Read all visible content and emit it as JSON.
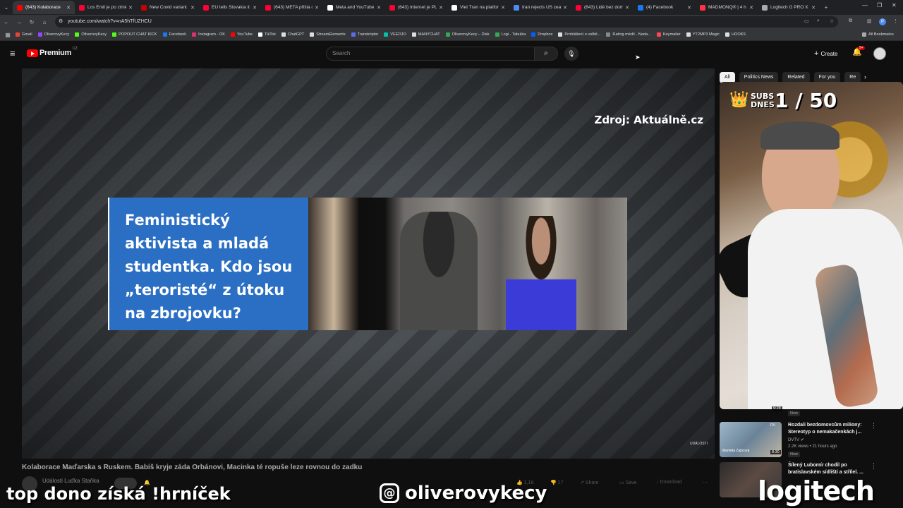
{
  "browser": {
    "tabs": [
      {
        "title": "(643) Kolaborace",
        "active": true,
        "color": "#ff0000"
      },
      {
        "title": "Los Emil je po zimě",
        "color": "#ff0033"
      },
      {
        "title": "New Covid variant",
        "color": "#cc0000"
      },
      {
        "title": "EU tells Slovakia it",
        "color": "#ff0033"
      },
      {
        "title": "(643) META přišla o",
        "color": "#ff0033"
      },
      {
        "title": "Meta and YouTube",
        "color": "#ffffff"
      },
      {
        "title": "(643) Internet je PL",
        "color": "#ff0033"
      },
      {
        "title": "Viet Tran na platfor",
        "color": "#ffffff"
      },
      {
        "title": "Iran rejects US cea",
        "color": "#4c8bf5"
      },
      {
        "title": "(643) Lidé bez dom",
        "color": "#ff0033"
      },
      {
        "title": "(4) Facebook",
        "color": "#1877f2"
      },
      {
        "title": "MADMONQ® | 4 h",
        "color": "#ff3344"
      },
      {
        "title": "Logitech G PRO X T",
        "color": "#aaaaaa"
      }
    ],
    "url": "youtube.com/watch?v=nA5hTfUZHCU",
    "bookmarks": [
      {
        "label": "Gmail",
        "color": "#ea4335"
      },
      {
        "label": "OliverovyKecy",
        "color": "#9146ff"
      },
      {
        "label": "OliverovyKecy",
        "color": "#53fc18"
      },
      {
        "label": "POPOUT CHAT KICK",
        "color": "#53fc18"
      },
      {
        "label": "Facebook",
        "color": "#1877f2"
      },
      {
        "label": "Instagram - OK",
        "color": "#e1306c"
      },
      {
        "label": "YouTube",
        "color": "#ff0000"
      },
      {
        "label": "TikTok",
        "color": "#ffffff"
      },
      {
        "label": "ChatGPT",
        "color": "#dddddd"
      },
      {
        "label": "StreamElements",
        "color": "#dddddd"
      },
      {
        "label": "Transkriptor",
        "color": "#5b6cf0"
      },
      {
        "label": "VEEDJO",
        "color": "#00c2a8"
      },
      {
        "label": "MANYCHAT",
        "color": "#dddddd"
      },
      {
        "label": "OliverovyKecy – Disk",
        "color": "#34a853"
      },
      {
        "label": "Logi - Tabulka",
        "color": "#34a853"
      },
      {
        "label": "Dropbox",
        "color": "#0061ff"
      },
      {
        "label": "Prohlášení o volbě...",
        "color": "#dddddd"
      },
      {
        "label": "Rating médií - Nada...",
        "color": "#888888"
      },
      {
        "label": "Keymailer",
        "color": "#ff4455"
      },
      {
        "label": "YT2MP3 Magic",
        "color": "#dddddd"
      },
      {
        "label": "HOOKS",
        "color": "#dddddd"
      }
    ],
    "all_bookmarks": "All Bookmarks"
  },
  "youtube": {
    "logo": "Premium",
    "region": "CZ",
    "search_placeholder": "Search",
    "create_label": "Create",
    "notif_count": "9+",
    "chips": [
      "All",
      "Politics News",
      "Related",
      "For you",
      "Re"
    ]
  },
  "video": {
    "source_label": "Zdroj: Aktuálně.cz",
    "card_title": "Feministický aktivista a mladá studentka. Kdo jsou „teroristé“ z útoku na zbrojovku?",
    "watermark": "UDÁLOSTI",
    "title": "Kolaborace Maďarska s Ruskem. Babiš kryje záda Orbánovi, Macinka té ropuše leze rovnou do zadku",
    "channel": "Události Luďka Staňka",
    "likes": "1,1K",
    "comments": "17",
    "share": "Share",
    "save": "Save",
    "download": "Download"
  },
  "stream": {
    "subs_label": "SUBS DNES",
    "subs_count": "1 / 50"
  },
  "recommendations": [
    {
      "duration": "9:28",
      "badge": "New",
      "title": "",
      "channel": "",
      "meta": ""
    },
    {
      "duration": "8:30",
      "badge": "New",
      "title": "Rozdali bezdomovcům miliony: Stereotyp o nemakačenkách j...",
      "channel": "DVTV",
      "meta": "2.2K views • 21 hours ago",
      "thumb_caption": "Markéta Zajícová"
    },
    {
      "duration": "",
      "badge": "",
      "title": "Šílený Lubomír chodil po bratislavském sídlišti a střílel. ...",
      "channel": "",
      "meta": ""
    }
  ],
  "overlays": {
    "left_text": "top dono získá !hrníček",
    "handle": "oliverovykecy",
    "brand": "logitech"
  }
}
